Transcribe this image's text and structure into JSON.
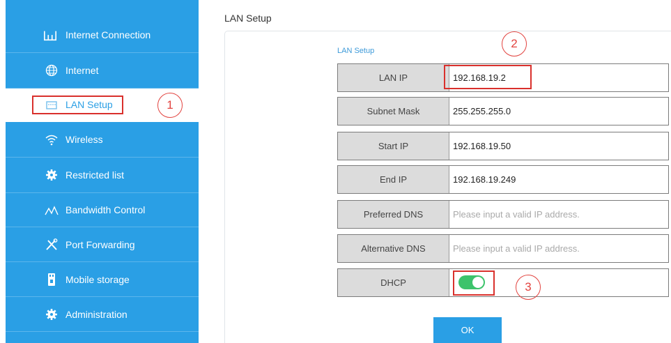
{
  "sidebar": {
    "items": [
      {
        "label": "Internet Connection",
        "icon": "network-icon"
      },
      {
        "label": "Internet",
        "icon": "globe-icon"
      },
      {
        "label": "LAN Setup",
        "icon": "lan-port-icon"
      },
      {
        "label": "Wireless",
        "icon": "wifi-icon"
      },
      {
        "label": "Restricted list",
        "icon": "gear-icon"
      },
      {
        "label": "Bandwidth Control",
        "icon": "bandwidth-icon"
      },
      {
        "label": "Port Forwarding",
        "icon": "tools-icon"
      },
      {
        "label": "Mobile storage",
        "icon": "storage-icon"
      },
      {
        "label": "Administration",
        "icon": "gear-icon"
      }
    ],
    "active_item": "LAN Setup"
  },
  "main": {
    "page_title": "LAN Setup",
    "section_label": "LAN Setup",
    "fields": {
      "lan_ip": {
        "label": "LAN IP",
        "value": "192.168.19.2"
      },
      "subnet_mask": {
        "label": "Subnet Mask",
        "value": "255.255.255.0"
      },
      "start_ip": {
        "label": "Start IP",
        "value": "192.168.19.50"
      },
      "end_ip": {
        "label": "End IP",
        "value": "192.168.19.249"
      },
      "preferred_dns": {
        "label": "Preferred DNS",
        "value": "",
        "placeholder": "Please input a valid IP address."
      },
      "alternative_dns": {
        "label": "Alternative DNS",
        "value": "",
        "placeholder": "Please input a valid IP address."
      }
    },
    "dhcp": {
      "label": "DHCP",
      "enabled": true
    },
    "ok_label": "OK"
  },
  "annotations": {
    "step1": "1",
    "step2": "2",
    "step3": "3"
  },
  "colors": {
    "sidebar_bg": "#2a9fe5",
    "accent": "#2a9fe5",
    "toggle_on": "#3dc36b",
    "annotation_red": "#d9302c"
  }
}
